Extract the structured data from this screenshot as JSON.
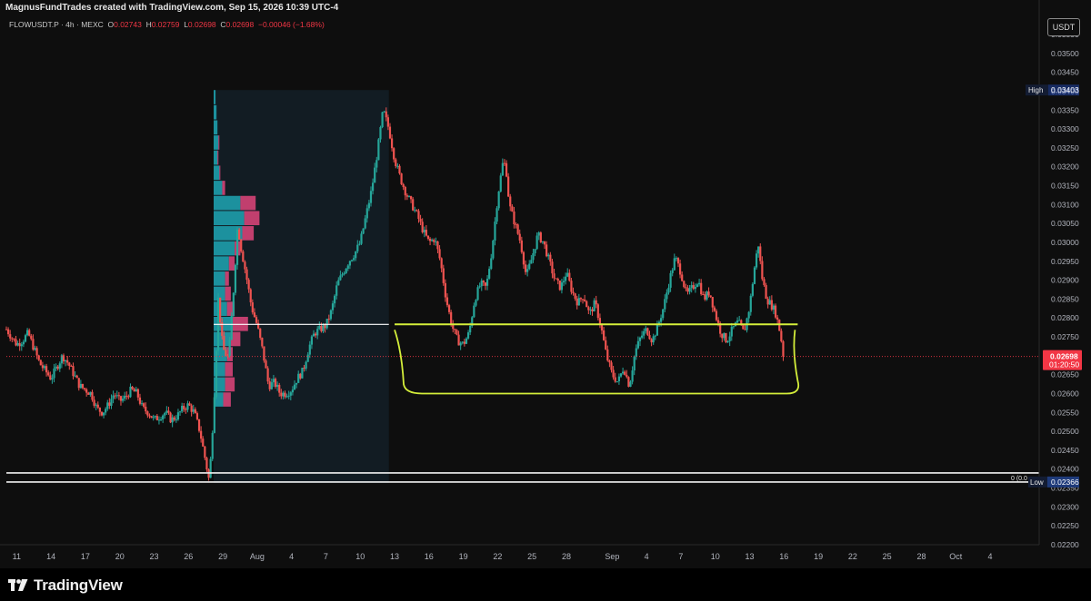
{
  "header": {
    "attribution": "MagnusFundTrades created with TradingView.com, Sep 15, 2026 10:39 UTC-4"
  },
  "symbol_bar": {
    "symbol": "FLOWUSDT.P · 4h · MEXC",
    "o_label": "O",
    "o_value": "0.02743",
    "h_label": "H",
    "h_value": "0.02759",
    "l_label": "L",
    "l_value": "0.02698",
    "c_label": "C",
    "c_value": "0.02698",
    "change": "−0.00046 (−1.68%)"
  },
  "price_axis": {
    "currency": "USDT",
    "high_label": "High",
    "high_value": "0.03403",
    "last_price": "0.02698",
    "countdown": "01:20:50",
    "low_label": "Low",
    "low_value": "0.02366",
    "fib_zero_label": "0 (0.0"
  },
  "footer": {
    "brand": "TradingView"
  },
  "colors": {
    "up": "#26a69a",
    "down": "#ef5350",
    "highlight": "#d4ee3a",
    "profile_teal": "#1fa6b4",
    "profile_pink": "#e0457b"
  },
  "chart_data": {
    "type": "candlestick",
    "timeframe": "4h",
    "y_axis": {
      "min": 0.022,
      "max": 0.0355,
      "ticks": [
        "0.03550",
        "0.03500",
        "0.03450",
        "0.03400",
        "0.03350",
        "0.03300",
        "0.03250",
        "0.03200",
        "0.03150",
        "0.03100",
        "0.03050",
        "0.03000",
        "0.02950",
        "0.02900",
        "0.02850",
        "0.02800",
        "0.02750",
        "0.02700",
        "0.02650",
        "0.02600",
        "0.02550",
        "0.02500",
        "0.02450",
        "0.02400",
        "0.02350",
        "0.02300",
        "0.02250",
        "0.02200"
      ]
    },
    "x_axis": {
      "ticks": [
        {
          "label": "11",
          "x": 11
        },
        {
          "label": "14",
          "x": 14
        },
        {
          "label": "17",
          "x": 17
        },
        {
          "label": "20",
          "x": 20
        },
        {
          "label": "23",
          "x": 23
        },
        {
          "label": "26",
          "x": 26
        },
        {
          "label": "29",
          "x": 29
        },
        {
          "label": "Aug",
          "x": 32
        },
        {
          "label": "4",
          "x": 35
        },
        {
          "label": "7",
          "x": 38
        },
        {
          "label": "10",
          "x": 41
        },
        {
          "label": "13",
          "x": 44
        },
        {
          "label": "16",
          "x": 47
        },
        {
          "label": "19",
          "x": 50
        },
        {
          "label": "22",
          "x": 53
        },
        {
          "label": "25",
          "x": 56
        },
        {
          "label": "28",
          "x": 59
        },
        {
          "label": "Sep",
          "x": 63
        },
        {
          "label": "4",
          "x": 66
        },
        {
          "label": "7",
          "x": 69
        },
        {
          "label": "10",
          "x": 72
        },
        {
          "label": "13",
          "x": 75
        },
        {
          "label": "16",
          "x": 78
        },
        {
          "label": "19",
          "x": 81
        },
        {
          "label": "22",
          "x": 84
        },
        {
          "label": "25",
          "x": 87
        },
        {
          "label": "28",
          "x": 90
        },
        {
          "label": "Oct",
          "x": 93
        },
        {
          "label": "4",
          "x": 96
        }
      ],
      "range": [
        10.1,
        98.3
      ]
    },
    "price_path": [
      {
        "x": 10.1,
        "y": 0.0277
      },
      {
        "x": 11,
        "y": 0.0273
      },
      {
        "x": 11.5,
        "y": 0.0274
      },
      {
        "x": 12,
        "y": 0.0276
      },
      {
        "x": 12.5,
        "y": 0.0272
      },
      {
        "x": 13,
        "y": 0.0268
      },
      {
        "x": 13.5,
        "y": 0.0266
      },
      {
        "x": 14,
        "y": 0.0264
      },
      {
        "x": 14.5,
        "y": 0.0267
      },
      {
        "x": 15,
        "y": 0.027
      },
      {
        "x": 15.5,
        "y": 0.0268
      },
      {
        "x": 16,
        "y": 0.0265
      },
      {
        "x": 16.5,
        "y": 0.0262
      },
      {
        "x": 17,
        "y": 0.0261
      },
      {
        "x": 17.5,
        "y": 0.026
      },
      {
        "x": 18,
        "y": 0.0256
      },
      {
        "x": 18.5,
        "y": 0.0255
      },
      {
        "x": 19,
        "y": 0.0257
      },
      {
        "x": 19.5,
        "y": 0.026
      },
      {
        "x": 20,
        "y": 0.0258
      },
      {
        "x": 20.5,
        "y": 0.0259
      },
      {
        "x": 21,
        "y": 0.0261
      },
      {
        "x": 21.5,
        "y": 0.026
      },
      {
        "x": 22,
        "y": 0.0256
      },
      {
        "x": 22.5,
        "y": 0.0255
      },
      {
        "x": 23,
        "y": 0.0253
      },
      {
        "x": 23.5,
        "y": 0.0254
      },
      {
        "x": 24,
        "y": 0.0255
      },
      {
        "x": 24.5,
        "y": 0.0253
      },
      {
        "x": 25,
        "y": 0.0254
      },
      {
        "x": 25.5,
        "y": 0.0256
      },
      {
        "x": 26,
        "y": 0.0257
      },
      {
        "x": 26.5,
        "y": 0.0255
      },
      {
        "x": 27,
        "y": 0.025
      },
      {
        "x": 27.5,
        "y": 0.0242
      },
      {
        "x": 27.8,
        "y": 0.0237
      },
      {
        "x": 28,
        "y": 0.0245
      },
      {
        "x": 28.3,
        "y": 0.0262
      },
      {
        "x": 28.6,
        "y": 0.0285
      },
      {
        "x": 29,
        "y": 0.0272
      },
      {
        "x": 29.5,
        "y": 0.0269
      },
      {
        "x": 30,
        "y": 0.029
      },
      {
        "x": 30.3,
        "y": 0.0305
      },
      {
        "x": 30.5,
        "y": 0.03
      },
      {
        "x": 31,
        "y": 0.0292
      },
      {
        "x": 31.5,
        "y": 0.0283
      },
      {
        "x": 32,
        "y": 0.0278
      },
      {
        "x": 32.5,
        "y": 0.0271
      },
      {
        "x": 33,
        "y": 0.0262
      },
      {
        "x": 33.5,
        "y": 0.0263
      },
      {
        "x": 34,
        "y": 0.026
      },
      {
        "x": 34.5,
        "y": 0.026
      },
      {
        "x": 35,
        "y": 0.0261
      },
      {
        "x": 35.5,
        "y": 0.0264
      },
      {
        "x": 36,
        "y": 0.0266
      },
      {
        "x": 36.5,
        "y": 0.0272
      },
      {
        "x": 37,
        "y": 0.0276
      },
      {
        "x": 37.5,
        "y": 0.0277
      },
      {
        "x": 38,
        "y": 0.0278
      },
      {
        "x": 38.5,
        "y": 0.0282
      },
      {
        "x": 39,
        "y": 0.0289
      },
      {
        "x": 39.5,
        "y": 0.0292
      },
      {
        "x": 40,
        "y": 0.0295
      },
      {
        "x": 40.5,
        "y": 0.0297
      },
      {
        "x": 41,
        "y": 0.03
      },
      {
        "x": 41.5,
        "y": 0.0307
      },
      {
        "x": 42,
        "y": 0.0314
      },
      {
        "x": 42.5,
        "y": 0.0324
      },
      {
        "x": 43,
        "y": 0.0335
      },
      {
        "x": 43.5,
        "y": 0.033
      },
      {
        "x": 44,
        "y": 0.0322
      },
      {
        "x": 44.5,
        "y": 0.0317
      },
      {
        "x": 45,
        "y": 0.0313
      },
      {
        "x": 45.5,
        "y": 0.031
      },
      {
        "x": 46,
        "y": 0.0307
      },
      {
        "x": 46.5,
        "y": 0.0303
      },
      {
        "x": 47,
        "y": 0.03
      },
      {
        "x": 47.5,
        "y": 0.0301
      },
      {
        "x": 48,
        "y": 0.0295
      },
      {
        "x": 48.5,
        "y": 0.0285
      },
      {
        "x": 49,
        "y": 0.0278
      },
      {
        "x": 49.5,
        "y": 0.0274
      },
      {
        "x": 50,
        "y": 0.0273
      },
      {
        "x": 50.5,
        "y": 0.0276
      },
      {
        "x": 51,
        "y": 0.0285
      },
      {
        "x": 51.5,
        "y": 0.0289
      },
      {
        "x": 52,
        "y": 0.0288
      },
      {
        "x": 52.5,
        "y": 0.0298
      },
      {
        "x": 53,
        "y": 0.0312
      },
      {
        "x": 53.5,
        "y": 0.0322
      },
      {
        "x": 53.8,
        "y": 0.0318
      },
      {
        "x": 54,
        "y": 0.031
      },
      {
        "x": 54.5,
        "y": 0.0305
      },
      {
        "x": 55,
        "y": 0.03
      },
      {
        "x": 55.5,
        "y": 0.0291
      },
      {
        "x": 56,
        "y": 0.0296
      },
      {
        "x": 56.5,
        "y": 0.0302
      },
      {
        "x": 57,
        "y": 0.03
      },
      {
        "x": 57.5,
        "y": 0.0295
      },
      {
        "x": 58,
        "y": 0.029
      },
      {
        "x": 58.5,
        "y": 0.0288
      },
      {
        "x": 59,
        "y": 0.0292
      },
      {
        "x": 59.5,
        "y": 0.0287
      },
      {
        "x": 60,
        "y": 0.0284
      },
      {
        "x": 60.5,
        "y": 0.0286
      },
      {
        "x": 61,
        "y": 0.0281
      },
      {
        "x": 61.5,
        "y": 0.0284
      },
      {
        "x": 62,
        "y": 0.0278
      },
      {
        "x": 62.5,
        "y": 0.027
      },
      {
        "x": 63,
        "y": 0.0265
      },
      {
        "x": 63.5,
        "y": 0.0263
      },
      {
        "x": 64,
        "y": 0.0267
      },
      {
        "x": 64.5,
        "y": 0.0262
      },
      {
        "x": 65,
        "y": 0.0271
      },
      {
        "x": 65.5,
        "y": 0.0275
      },
      {
        "x": 66,
        "y": 0.0277
      },
      {
        "x": 66.5,
        "y": 0.0274
      },
      {
        "x": 67,
        "y": 0.0278
      },
      {
        "x": 67.5,
        "y": 0.0283
      },
      {
        "x": 68,
        "y": 0.029
      },
      {
        "x": 68.5,
        "y": 0.0296
      },
      {
        "x": 69,
        "y": 0.0292
      },
      {
        "x": 69.5,
        "y": 0.0286
      },
      {
        "x": 70,
        "y": 0.0288
      },
      {
        "x": 70.5,
        "y": 0.029
      },
      {
        "x": 71,
        "y": 0.0285
      },
      {
        "x": 71.5,
        "y": 0.0287
      },
      {
        "x": 72,
        "y": 0.0281
      },
      {
        "x": 72.5,
        "y": 0.0276
      },
      {
        "x": 73,
        "y": 0.0274
      },
      {
        "x": 73.5,
        "y": 0.0277
      },
      {
        "x": 74,
        "y": 0.0279
      },
      {
        "x": 74.5,
        "y": 0.0276
      },
      {
        "x": 75,
        "y": 0.0283
      },
      {
        "x": 75.5,
        "y": 0.0295
      },
      {
        "x": 75.8,
        "y": 0.03
      },
      {
        "x": 76,
        "y": 0.0292
      },
      {
        "x": 76.5,
        "y": 0.0285
      },
      {
        "x": 77,
        "y": 0.0283
      },
      {
        "x": 77.3,
        "y": 0.0281
      },
      {
        "x": 77.6,
        "y": 0.0277
      },
      {
        "x": 78,
        "y": 0.027
      }
    ],
    "volume_profile": {
      "price_rows": [
        0.03383,
        0.03343,
        0.03303,
        0.03263,
        0.03223,
        0.03183,
        0.03143,
        0.03103,
        0.03063,
        0.03023,
        0.02983,
        0.02943,
        0.02903,
        0.02863,
        0.02823,
        0.02783,
        0.02743,
        0.02703,
        0.02663,
        0.02623,
        0.02583,
        0.02543,
        0.02503,
        0.02463,
        0.02423,
        0.02383
      ],
      "teal": [
        2,
        3,
        4,
        5,
        4,
        6,
        9,
        28,
        32,
        30,
        22,
        16,
        12,
        12,
        14,
        20,
        18,
        14,
        12,
        12,
        10,
        0,
        0,
        0,
        0,
        0
      ],
      "pink": [
        0,
        0,
        0,
        1,
        1,
        1,
        3,
        16,
        16,
        12,
        6,
        6,
        4,
        6,
        8,
        16,
        10,
        6,
        8,
        10,
        8,
        0,
        0,
        0,
        0,
        0
      ],
      "poc": 0.02783,
      "x_range": [
        28.2,
        43.5
      ]
    },
    "annotations": {
      "support_line_price": 0.02783,
      "range_rect_low": 0.026,
      "range_rect_x": [
        44,
        79.2
      ],
      "lows_lines": [
        0.0239,
        0.02366
      ],
      "current_price": 0.02698
    }
  }
}
